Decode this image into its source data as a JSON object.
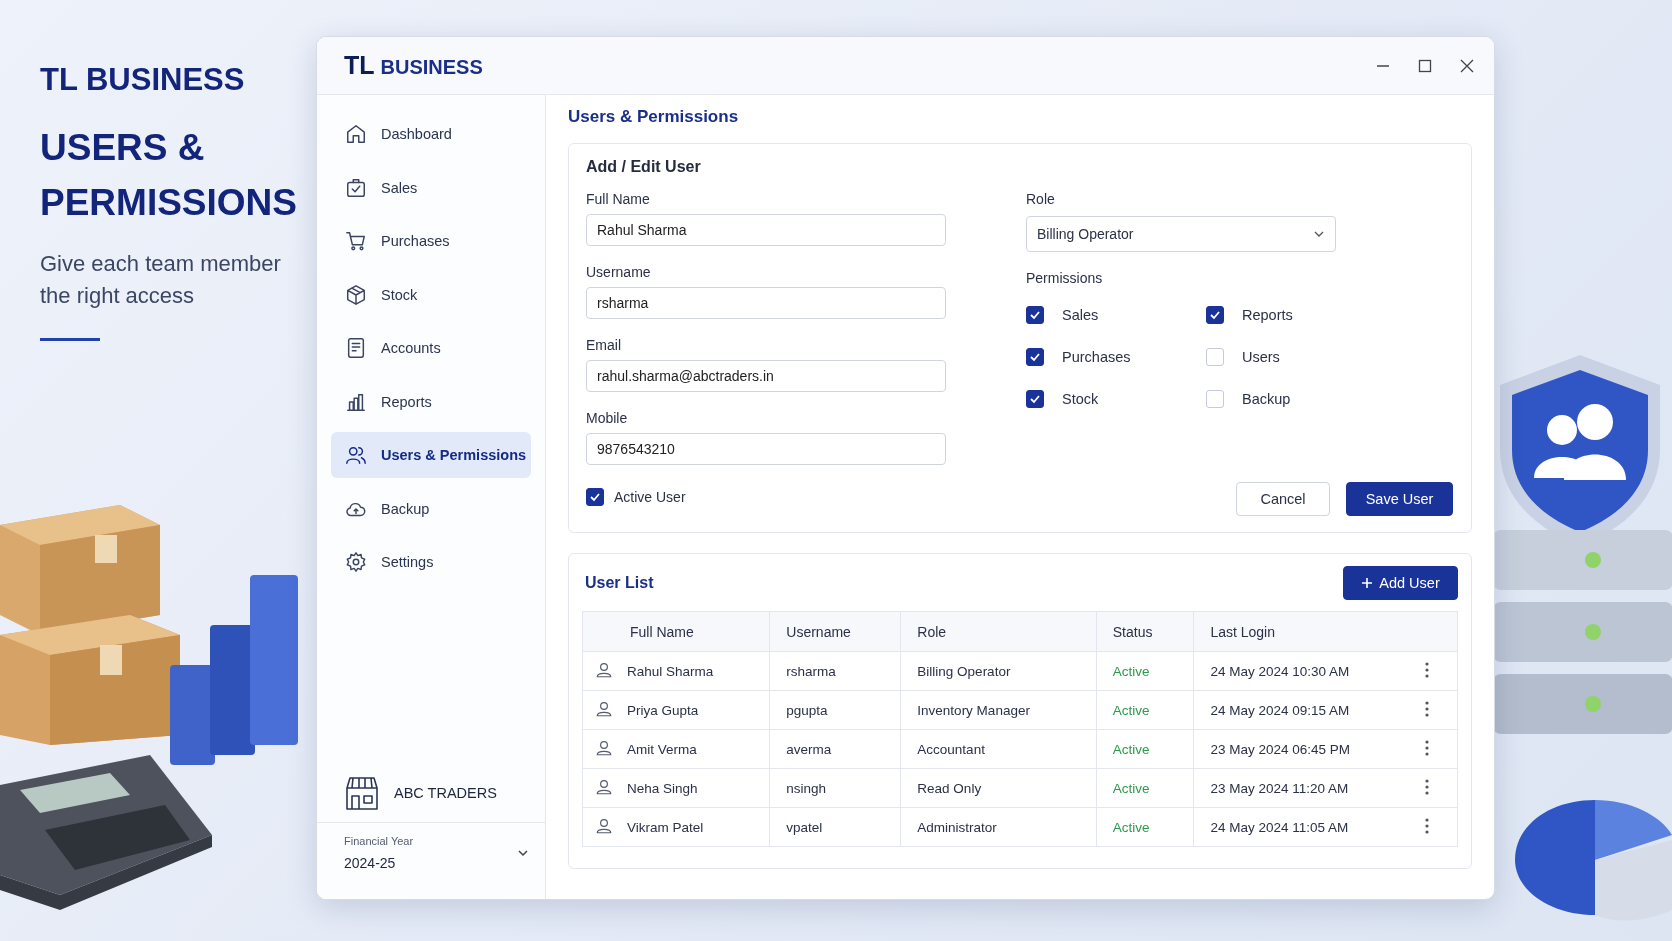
{
  "promo": {
    "brand": "TL BUSINESS",
    "headline": "USERS & PERMISSIONS",
    "tagline": "Give each team member the right access"
  },
  "window": {
    "logo_mark": "TL",
    "logo_text": "BUSINESS"
  },
  "sidebar": {
    "items": [
      {
        "label": "Dashboard",
        "selected": false
      },
      {
        "label": "Sales",
        "selected": false
      },
      {
        "label": "Purchases",
        "selected": false
      },
      {
        "label": "Stock",
        "selected": false
      },
      {
        "label": "Accounts",
        "selected": false
      },
      {
        "label": "Reports",
        "selected": false
      },
      {
        "label": "Users & Permissions",
        "selected": true
      },
      {
        "label": "Backup",
        "selected": false
      },
      {
        "label": "Settings",
        "selected": false
      }
    ],
    "company": "ABC TRADERS",
    "financial_year_label": "Financial Year",
    "financial_year": "2024-25"
  },
  "page_title": "Users & Permissions",
  "form": {
    "title": "Add / Edit User",
    "fields": [
      {
        "label": "Full Name",
        "value": "Rahul Sharma"
      },
      {
        "label": "Username",
        "value": "rsharma"
      },
      {
        "label": "Email",
        "value": "rahul.sharma@abctraders.in"
      },
      {
        "label": "Mobile",
        "value": "9876543210"
      }
    ],
    "active_user": {
      "label": "Active User",
      "checked": true
    },
    "role": {
      "label": "Role",
      "value": "Billing Operator"
    },
    "permissions": {
      "label": "Permissions",
      "items": [
        {
          "label": "Sales",
          "checked": true
        },
        {
          "label": "Reports",
          "checked": true
        },
        {
          "label": "Purchases",
          "checked": true
        },
        {
          "label": "Users",
          "checked": false
        },
        {
          "label": "Stock",
          "checked": true
        },
        {
          "label": "Backup",
          "checked": false
        }
      ]
    },
    "buttons": {
      "cancel": "Cancel",
      "save": "Save User"
    }
  },
  "user_list": {
    "title": "User List",
    "add_button": "Add User",
    "columns": [
      "Full Name",
      "Username",
      "Role",
      "Status",
      "Last Login"
    ],
    "rows": [
      {
        "full_name": "Rahul Sharma",
        "username": "rsharma",
        "role": "Billing Operator",
        "status": "Active",
        "last_login": "24 May 2024 10:30 AM"
      },
      {
        "full_name": "Priya Gupta",
        "username": "pgupta",
        "role": "Inventory Manager",
        "status": "Active",
        "last_login": "24 May 2024 09:15 AM"
      },
      {
        "full_name": "Amit Verma",
        "username": "averma",
        "role": "Accountant",
        "status": "Active",
        "last_login": "23 May 2024 06:45 PM"
      },
      {
        "full_name": "Neha Singh",
        "username": "nsingh",
        "role": "Read Only",
        "status": "Active",
        "last_login": "23 May 2024 11:20 AM"
      },
      {
        "full_name": "Vikram Patel",
        "username": "vpatel",
        "role": "Administrator",
        "status": "Active",
        "last_login": "24 May 2024 11:05 AM"
      }
    ]
  }
}
